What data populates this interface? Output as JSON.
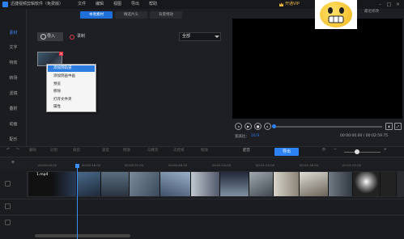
{
  "titlebar": {
    "app_title": "迅捷视频剪辑软件（免费版）",
    "menus": [
      "文件",
      "编辑",
      "视图",
      "导出",
      "帮助"
    ],
    "vip": "开通VIP",
    "emoji_text": "最近修改"
  },
  "sidebar": {
    "items": [
      {
        "label": "素材",
        "icon": "media-icon",
        "active": true
      },
      {
        "label": "文字",
        "icon": "text-icon",
        "active": false
      },
      {
        "label": "特效",
        "icon": "effects-icon",
        "active": false
      },
      {
        "label": "转场",
        "icon": "transition-icon",
        "active": false
      },
      {
        "label": "滤镜",
        "icon": "filter-icon",
        "active": false
      },
      {
        "label": "叠附",
        "icon": "overlay-icon",
        "active": false
      },
      {
        "label": "动画",
        "icon": "animation-icon",
        "active": false
      },
      {
        "label": "配乐",
        "icon": "music-icon",
        "active": false
      }
    ]
  },
  "media": {
    "tabs": [
      "本地素材",
      "精选片头",
      "背景特效"
    ],
    "import_label": "导入",
    "record_label": "录制",
    "filter_value": "全部",
    "context_menu": [
      "添加到轨道",
      "添加到画中画",
      "预览",
      "移除",
      "打开文件夹",
      "属性"
    ]
  },
  "preview": {
    "ratio_label": "宽高比：",
    "ratio_value": "16:9",
    "time": "00:00:00.00 / 00:02:59.75",
    "progress": 0
  },
  "toolbar": {
    "items": [
      "撤销",
      "重做",
      "删除",
      "分割",
      "裁剪",
      "速度",
      "倒放",
      "马赛克",
      "冻结帧",
      "缩放"
    ],
    "export_label": "导出",
    "dub_label": "配音"
  },
  "timeline": {
    "ticks": [
      "00:00:00.00",
      "00:00:16.00",
      "00:00:32.00",
      "00:00:48.00",
      "00:01:04.00",
      "00:01:20.00",
      "00:01:36.00",
      "00:01:52.00"
    ],
    "clip_name": "1.mp4"
  },
  "colors": {
    "accent": "#2d82f3",
    "background": "#1e1f24"
  }
}
